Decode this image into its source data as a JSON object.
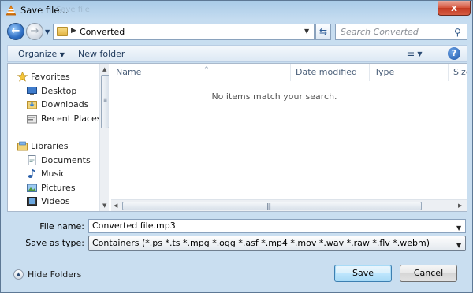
{
  "window": {
    "title": "Save file...",
    "title_ghost": "Save file",
    "close_label": "x"
  },
  "address": {
    "path_segments": [
      "Converted"
    ],
    "search_placeholder": "Search Converted"
  },
  "toolbar": {
    "organize": "Organize",
    "new_folder": "New folder"
  },
  "nav_pane": {
    "groups": [
      {
        "label": "Favorites",
        "icon": "star-icon",
        "items": [
          {
            "label": "Desktop",
            "icon": "desktop-icon"
          },
          {
            "label": "Downloads",
            "icon": "downloads-icon"
          },
          {
            "label": "Recent Places",
            "icon": "recent-places-icon"
          }
        ]
      },
      {
        "label": "Libraries",
        "icon": "libraries-icon",
        "items": [
          {
            "label": "Documents",
            "icon": "documents-icon"
          },
          {
            "label": "Music",
            "icon": "music-icon"
          },
          {
            "label": "Pictures",
            "icon": "pictures-icon"
          },
          {
            "label": "Videos",
            "icon": "videos-icon"
          }
        ]
      }
    ]
  },
  "file_list": {
    "columns": [
      "Name",
      "Date modified",
      "Type",
      "Size"
    ],
    "empty_message": "No items match your search."
  },
  "form": {
    "filename_label": "File name:",
    "filename_value": "Converted file.mp3",
    "type_label": "Save as type:",
    "type_value": "Containers (*.ps *.ts *.mpg *.ogg *.asf *.mp4 *.mov *.wav *.raw *.flv *.webm)"
  },
  "footer": {
    "hide_folders": "Hide Folders",
    "save": "Save",
    "cancel": "Cancel"
  },
  "colors": {
    "chrome": "#c9def0",
    "close_button": "#c9452c",
    "help_button": "#1d56a8"
  }
}
